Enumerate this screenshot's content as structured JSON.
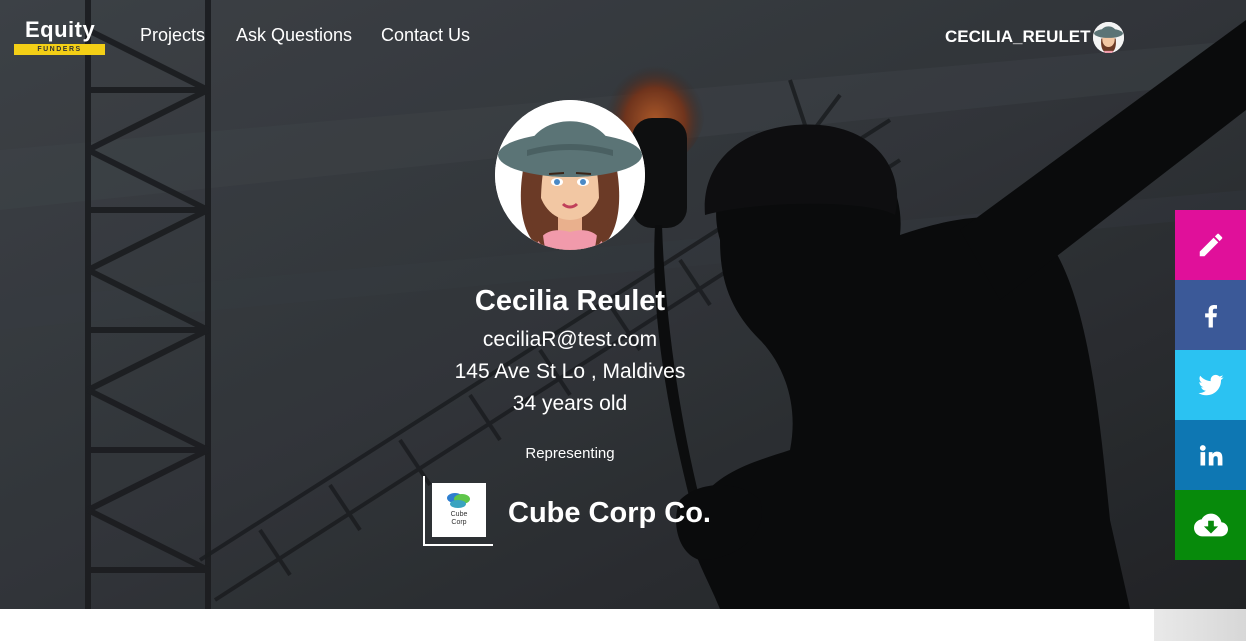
{
  "nav": {
    "logo_text": "Equity",
    "logo_sub": "FUNDERS",
    "links": [
      {
        "label": "Projects"
      },
      {
        "label": "Ask Questions"
      },
      {
        "label": "Contact Us"
      }
    ],
    "user": {
      "name": "CECILIA_REULET"
    }
  },
  "profile": {
    "name": "Cecilia Reulet",
    "email": "ceciliaR@test.com",
    "address": "145 Ave St Lo , Maldives",
    "age": "34 years old",
    "representing_label": "Representing",
    "company": {
      "name": "Cube Corp Co.",
      "logo_text_1": "Cube",
      "logo_text_2": "Corp"
    }
  },
  "side_buttons": [
    {
      "icon": "pencil-icon",
      "color": "#e0109a"
    },
    {
      "icon": "facebook-icon",
      "color": "#3b5998"
    },
    {
      "icon": "twitter-icon",
      "color": "#2bc2f2"
    },
    {
      "icon": "linkedin-icon",
      "color": "#0e77b3"
    },
    {
      "icon": "cloud-download-icon",
      "color": "#078a0b"
    }
  ],
  "colors": {
    "logo_yellow": "#f3cf16",
    "hero_dark": "#2d3034"
  }
}
